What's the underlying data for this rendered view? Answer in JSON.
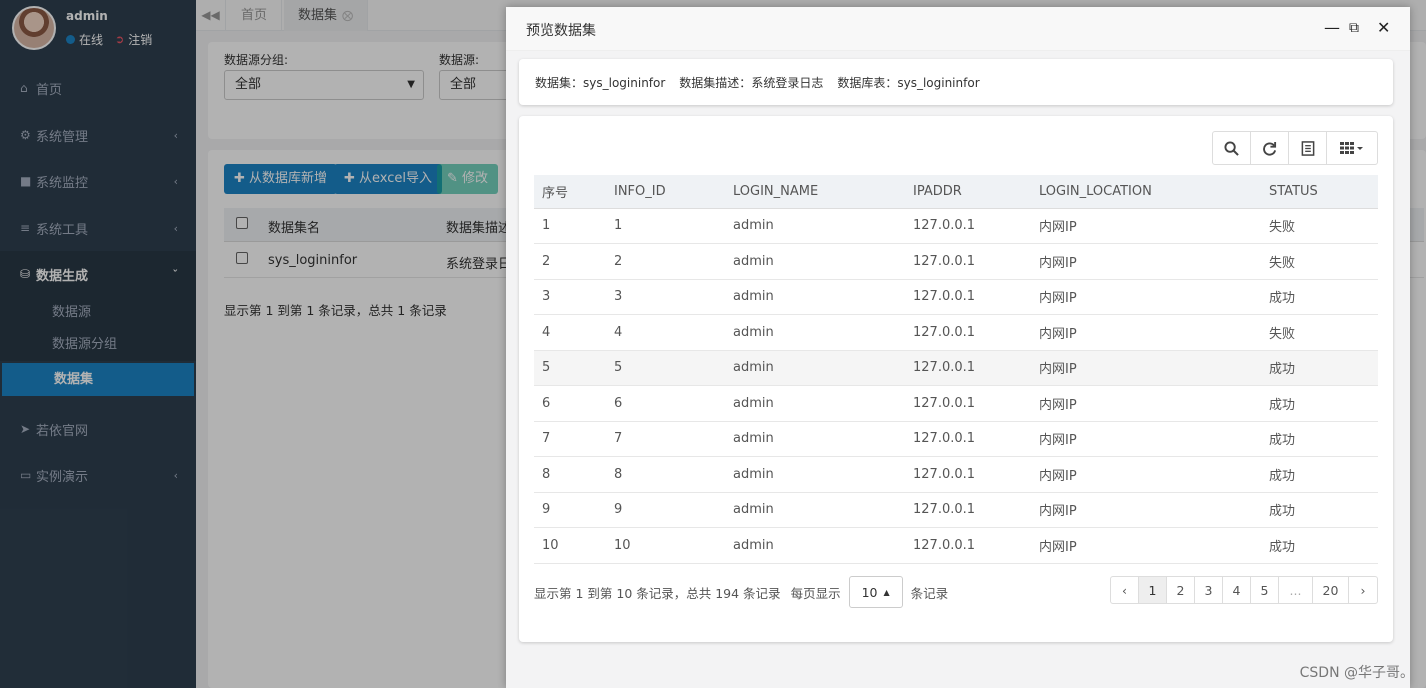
{
  "user": {
    "name": "admin",
    "status": "在线",
    "logout": "注销"
  },
  "sidebar": {
    "items": [
      {
        "label": "首页",
        "icon": "home-icon"
      },
      {
        "label": "系统管理",
        "icon": "gear-icon"
      },
      {
        "label": "系统监控",
        "icon": "video-icon"
      },
      {
        "label": "系统工具",
        "icon": "bars-icon"
      },
      {
        "label": "数据生成",
        "icon": "database-icon"
      },
      {
        "label": "若依官网",
        "icon": "location-arrow-icon"
      },
      {
        "label": "实例演示",
        "icon": "desktop-icon"
      }
    ],
    "subitems": [
      {
        "label": "数据源"
      },
      {
        "label": "数据源分组"
      },
      {
        "label": "数据集"
      }
    ]
  },
  "tabs": [
    {
      "label": "首页"
    },
    {
      "label": "数据集"
    }
  ],
  "filter": {
    "group_label": "数据源分组:",
    "group_value": "全部",
    "source_label": "数据源:",
    "source_value": "全部"
  },
  "toolbar": {
    "add_db": "从数据库新增",
    "import_excel": "从excel导入",
    "edit": "修改"
  },
  "list": {
    "headers": [
      "数据集名",
      "数据集描述"
    ],
    "rows": [
      {
        "name": "sys_logininfor",
        "desc": "系统登录日"
      }
    ],
    "summary": "显示第 1 到第 1 条记录，总共 1 条记录"
  },
  "modal": {
    "title": "预览数据集",
    "info": {
      "dataset_label": "数据集：",
      "dataset_value": "sys_logininfor",
      "desc_label": "数据集描述：",
      "desc_value": "系统登录日志",
      "table_label": "数据库表：",
      "table_value": "sys_logininfor"
    },
    "columns": [
      "序号",
      "INFO_ID",
      "LOGIN_NAME",
      "IPADDR",
      "LOGIN_LOCATION",
      "STATUS"
    ],
    "rows": [
      [
        "1",
        "1",
        "admin",
        "127.0.0.1",
        "内网IP",
        "失败"
      ],
      [
        "2",
        "2",
        "admin",
        "127.0.0.1",
        "内网IP",
        "失败"
      ],
      [
        "3",
        "3",
        "admin",
        "127.0.0.1",
        "内网IP",
        "成功"
      ],
      [
        "4",
        "4",
        "admin",
        "127.0.0.1",
        "内网IP",
        "失败"
      ],
      [
        "5",
        "5",
        "admin",
        "127.0.0.1",
        "内网IP",
        "成功"
      ],
      [
        "6",
        "6",
        "admin",
        "127.0.0.1",
        "内网IP",
        "成功"
      ],
      [
        "7",
        "7",
        "admin",
        "127.0.0.1",
        "内网IP",
        "成功"
      ],
      [
        "8",
        "8",
        "admin",
        "127.0.0.1",
        "内网IP",
        "成功"
      ],
      [
        "9",
        "9",
        "admin",
        "127.0.0.1",
        "内网IP",
        "成功"
      ],
      [
        "10",
        "10",
        "admin",
        "127.0.0.1",
        "内网IP",
        "成功"
      ]
    ],
    "pagination": {
      "summary": "显示第 1 到第 10 条记录，总共 194 条记录",
      "per_page_prefix": "每页显示",
      "per_page_value": "10",
      "per_page_suffix": "条记录",
      "prev": "‹",
      "pages": [
        "1",
        "2",
        "3",
        "4",
        "5",
        "...",
        "20"
      ],
      "next": "›",
      "current": "1"
    }
  },
  "watermark": "CSDN @华子哥。"
}
